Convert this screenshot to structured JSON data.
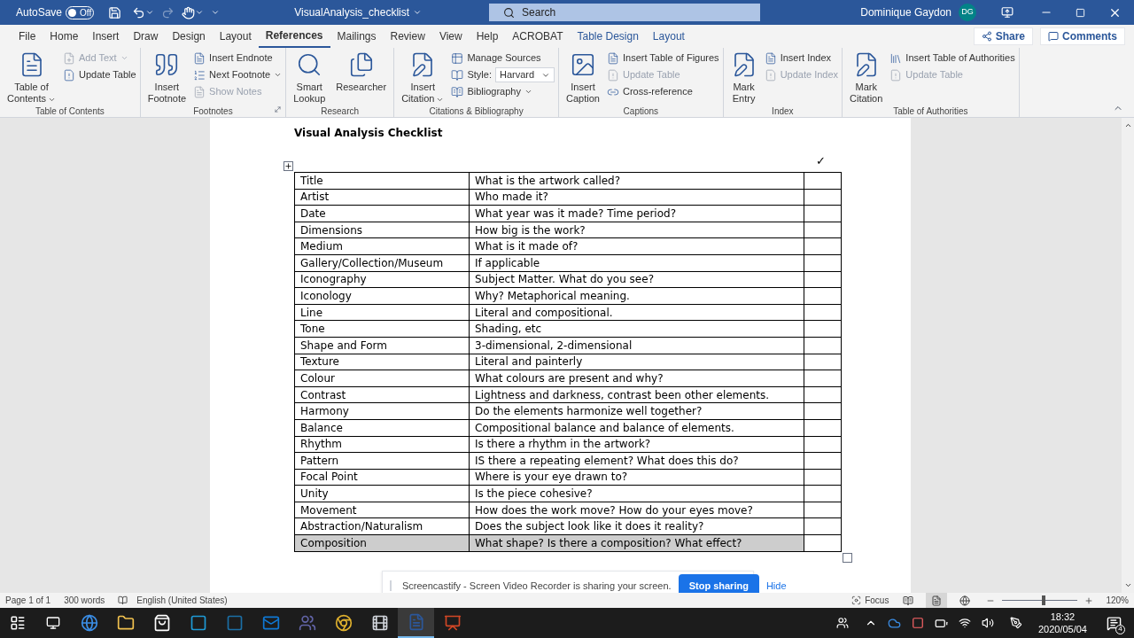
{
  "title_bar": {
    "autosave_label": "AutoSave",
    "autosave_toggle": {
      "label": "Off",
      "on": false
    },
    "document_title": "VisualAnalysis_checklist",
    "search_placeholder": "Search",
    "user_name": "Dominique Gaydon",
    "user_initials": "DG"
  },
  "menu_tabs": [
    {
      "label": "File",
      "selected": false,
      "contextual": false
    },
    {
      "label": "Home",
      "selected": false,
      "contextual": false
    },
    {
      "label": "Insert",
      "selected": false,
      "contextual": false
    },
    {
      "label": "Draw",
      "selected": false,
      "contextual": false
    },
    {
      "label": "Design",
      "selected": false,
      "contextual": false
    },
    {
      "label": "Layout",
      "selected": false,
      "contextual": false
    },
    {
      "label": "References",
      "selected": true,
      "contextual": false
    },
    {
      "label": "Mailings",
      "selected": false,
      "contextual": false
    },
    {
      "label": "Review",
      "selected": false,
      "contextual": false
    },
    {
      "label": "View",
      "selected": false,
      "contextual": false
    },
    {
      "label": "Help",
      "selected": false,
      "contextual": false
    },
    {
      "label": "ACROBAT",
      "selected": false,
      "contextual": false
    },
    {
      "label": "Table Design",
      "selected": false,
      "contextual": true
    },
    {
      "label": "Layout",
      "selected": false,
      "contextual": true
    }
  ],
  "share_button": "Share",
  "comments_button": "Comments",
  "ribbon_groups": [
    {
      "label": "Table of Contents",
      "launcher": false,
      "items": [
        {
          "kind": "large",
          "label": "Table of\nContents",
          "dropdown": true,
          "disabled": false
        },
        {
          "kind": "stack",
          "items": [
            {
              "label": "Add Text",
              "dropdown": true,
              "disabled": true
            },
            {
              "label": "Update Table",
              "dropdown": false,
              "disabled": false
            }
          ]
        }
      ]
    },
    {
      "label": "Footnotes",
      "launcher": true,
      "items": [
        {
          "kind": "large",
          "label": "Insert\nFootnote",
          "dropdown": false,
          "disabled": false
        },
        {
          "kind": "stack",
          "items": [
            {
              "label": "Insert Endnote",
              "dropdown": false,
              "disabled": false
            },
            {
              "label": "Next Footnote",
              "dropdown": true,
              "disabled": false
            },
            {
              "label": "Show Notes",
              "dropdown": false,
              "disabled": true
            }
          ]
        }
      ]
    },
    {
      "label": "Research",
      "launcher": false,
      "items": [
        {
          "kind": "large",
          "label": "Smart\nLookup",
          "dropdown": false,
          "disabled": false
        },
        {
          "kind": "large",
          "label": "Researcher",
          "dropdown": false,
          "disabled": false
        }
      ]
    },
    {
      "label": "Citations & Bibliography",
      "launcher": false,
      "items": [
        {
          "kind": "large",
          "label": "Insert\nCitation",
          "dropdown": true,
          "disabled": false
        },
        {
          "kind": "stack",
          "items": [
            {
              "label": "Manage Sources",
              "dropdown": false,
              "disabled": false
            },
            {
              "label": "Style:",
              "value": "Harvard",
              "dropdown": true,
              "disabled": false
            },
            {
              "label": "Bibliography",
              "dropdown": true,
              "disabled": false
            }
          ]
        }
      ]
    },
    {
      "label": "Captions",
      "launcher": false,
      "items": [
        {
          "kind": "large",
          "label": "Insert\nCaption",
          "dropdown": false,
          "disabled": false
        },
        {
          "kind": "stack",
          "items": [
            {
              "label": "Insert Table of Figures",
              "dropdown": false,
              "disabled": false
            },
            {
              "label": "Update Table",
              "dropdown": false,
              "disabled": true
            },
            {
              "label": "Cross-reference",
              "dropdown": false,
              "disabled": false
            }
          ]
        }
      ]
    },
    {
      "label": "Index",
      "launcher": false,
      "items": [
        {
          "kind": "large",
          "label": "Mark\nEntry",
          "dropdown": false,
          "disabled": false
        },
        {
          "kind": "stack",
          "items": [
            {
              "label": "Insert Index",
              "dropdown": false,
              "disabled": false
            },
            {
              "label": "Update Index",
              "dropdown": false,
              "disabled": true
            }
          ]
        }
      ]
    },
    {
      "label": "Table of Authorities",
      "launcher": false,
      "items": [
        {
          "kind": "large",
          "label": "Mark\nCitation",
          "dropdown": false,
          "disabled": false
        },
        {
          "kind": "stack",
          "items": [
            {
              "label": "Insert Table of Authorities",
              "dropdown": false,
              "disabled": false
            },
            {
              "label": "Update Table",
              "dropdown": false,
              "disabled": true
            }
          ]
        }
      ]
    }
  ],
  "document": {
    "heading": "Visual Analysis Checklist",
    "check_column_mark": "✓",
    "rows": [
      {
        "cells": [
          "Title",
          "What is the artwork called?",
          ""
        ],
        "selected": false
      },
      {
        "cells": [
          "Artist",
          "Who made it?",
          ""
        ],
        "selected": false
      },
      {
        "cells": [
          "Date",
          "What year was it made? Time period?",
          ""
        ],
        "selected": false
      },
      {
        "cells": [
          "Dimensions",
          "How big is the work?",
          ""
        ],
        "selected": false
      },
      {
        "cells": [
          "Medium",
          "What is it made of?",
          ""
        ],
        "selected": false
      },
      {
        "cells": [
          "Gallery/Collection/Museum",
          "If applicable",
          ""
        ],
        "selected": false
      },
      {
        "cells": [
          "Iconography",
          "Subject Matter. What do you see?",
          ""
        ],
        "selected": false
      },
      {
        "cells": [
          "Iconology",
          "Why? Metaphorical meaning.",
          ""
        ],
        "selected": false
      },
      {
        "cells": [
          "Line",
          "Literal and compositional.",
          ""
        ],
        "selected": false
      },
      {
        "cells": [
          "Tone",
          "Shading, etc",
          ""
        ],
        "selected": false
      },
      {
        "cells": [
          "Shape and Form",
          "3-dimensional, 2-dimensional",
          ""
        ],
        "selected": false
      },
      {
        "cells": [
          "Texture",
          "Literal and painterly",
          ""
        ],
        "selected": false
      },
      {
        "cells": [
          "Colour",
          "What colours are present and why?",
          ""
        ],
        "selected": false
      },
      {
        "cells": [
          "Contrast",
          "Lightness and darkness, contrast been other elements.",
          ""
        ],
        "selected": false
      },
      {
        "cells": [
          "Harmony",
          "Do the elements harmonize well together?",
          ""
        ],
        "selected": false
      },
      {
        "cells": [
          "Balance",
          "Compositional balance and balance of elements.",
          ""
        ],
        "selected": false
      },
      {
        "cells": [
          "Rhythm",
          "Is there a rhythm in the artwork?",
          ""
        ],
        "selected": false
      },
      {
        "cells": [
          "Pattern",
          "IS there a repeating element? What does this do?",
          ""
        ],
        "selected": false
      },
      {
        "cells": [
          "Focal Point",
          "Where is your eye drawn to?",
          ""
        ],
        "selected": false
      },
      {
        "cells": [
          "Unity",
          "Is the piece cohesive?",
          ""
        ],
        "selected": false
      },
      {
        "cells": [
          "Movement",
          "How does the work move? How do your eyes move?",
          ""
        ],
        "selected": false
      },
      {
        "cells": [
          "Abstraction/Naturalism",
          "Does the subject look like it does it reality?",
          ""
        ],
        "selected": false
      },
      {
        "cells": [
          "Composition",
          "What shape? Is there a composition? What effect?",
          ""
        ],
        "selected": true
      }
    ]
  },
  "notification": {
    "text": "Screencastify - Screen Video Recorder is sharing your screen.",
    "primary_button": "Stop sharing",
    "link": "Hide"
  },
  "status_bar": {
    "page": "Page 1 of 1",
    "words": "300 words",
    "language": "English (United States)",
    "focus": "Focus",
    "level": 0.53,
    "zoom": "120%"
  },
  "taskbar": {
    "apps": [
      {
        "selected": false
      },
      {
        "selected": false
      },
      {
        "selected": false
      },
      {
        "selected": false
      },
      {
        "selected": false
      },
      {
        "selected": false
      },
      {
        "selected": false
      },
      {
        "selected": false
      },
      {
        "selected": false
      },
      {
        "selected": true
      },
      {
        "selected": false
      }
    ],
    "time": "18:32",
    "date": "2020/05/04",
    "notification_count": "4"
  }
}
